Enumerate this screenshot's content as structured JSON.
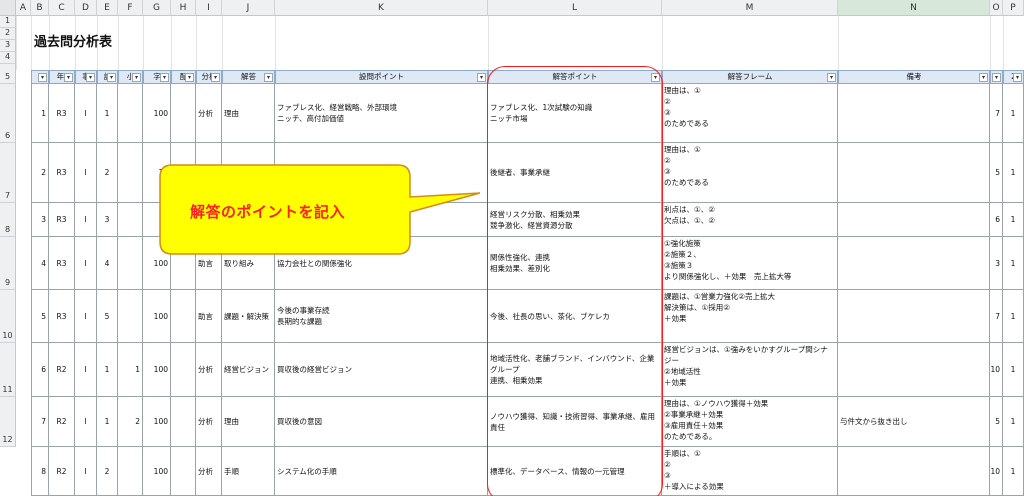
{
  "title": "過去問分析表",
  "columns": [
    "A",
    "B",
    "C",
    "D",
    "E",
    "F",
    "G",
    "H",
    "I",
    "J",
    "K",
    "L",
    "M",
    "N",
    "O",
    "P"
  ],
  "selected_column": "N",
  "row_numbers": [
    "1",
    "2",
    "3",
    "4",
    "5",
    "6",
    "7",
    "8",
    "9",
    "10",
    "11",
    "12"
  ],
  "header": [
    "I",
    "年(",
    "事",
    "設",
    "小",
    "字",
    "配",
    "分析",
    "解答",
    "設問ポイント",
    "解答ポイント",
    "解答フレーム",
    "備考",
    "1",
    "2"
  ],
  "rows": [
    {
      "n": "1",
      "year": "R3",
      "jirei": "I",
      "q": "1",
      "sub": "",
      "chars": "100",
      "haiten": "",
      "bunseki": "分析",
      "kaito": "理由",
      "setsumon": "ファブレス化、経営戦略、外部環境\nニッチ、高付加価値",
      "point": "ファブレス化、1次試験の知識\nニッチ市場",
      "frame": "理由は、①\n②\n③\nのためである",
      "biko": "",
      "o": "7",
      "p": "1"
    },
    {
      "n": "2",
      "year": "R3",
      "jirei": "I",
      "q": "2",
      "sub": "",
      "chars": "10",
      "haiten": "",
      "bunseki": "",
      "kaito": "",
      "setsumon": "",
      "point": "後継者、事業承継",
      "frame": "理由は、①\n②\n③\nのためである",
      "biko": "",
      "o": "5",
      "p": "1"
    },
    {
      "n": "3",
      "year": "R3",
      "jirei": "I",
      "q": "3",
      "sub": "",
      "chars": "1",
      "haiten": "",
      "bunseki": "",
      "kaito": "",
      "setsumon": "",
      "point": "経営リスク分散、相乗効果\n競争激化、経営資源分散",
      "frame": "利点は、①、②\n欠点は、①、②",
      "biko": "",
      "o": "6",
      "p": "1"
    },
    {
      "n": "4",
      "year": "R3",
      "jirei": "I",
      "q": "4",
      "sub": "",
      "chars": "100",
      "haiten": "",
      "bunseki": "助言",
      "kaito": "取り組み",
      "setsumon": "協力会社との関係強化",
      "point": "関係性強化、連携\n相乗効果、差別化",
      "frame": "①強化施策\n②施策２、\n③施策３\nより関係強化し、＋効果　売上拡大等",
      "biko": "",
      "o": "3",
      "p": "1"
    },
    {
      "n": "5",
      "year": "R3",
      "jirei": "I",
      "q": "5",
      "sub": "",
      "chars": "100",
      "haiten": "",
      "bunseki": "助言",
      "kaito": "課題・解決策",
      "setsumon": "今後の事業存続\n長期的な課題",
      "point": "今後、社長の思い、茶化、ブケレカ",
      "frame": "課題は、①営業力強化②売上拡大\n解決策は、①採用②\n＋効果",
      "biko": "",
      "o": "7",
      "p": "1"
    },
    {
      "n": "6",
      "year": "R2",
      "jirei": "I",
      "q": "1",
      "sub": "1",
      "chars": "100",
      "haiten": "",
      "bunseki": "分析",
      "kaito": "経営ビジョン",
      "setsumon": "買収後の経営ビジョン",
      "point": "地域活性化、老舗ブランド、インバウンド、企業グループ\n連携、相乗効果",
      "frame": "経営ビジョンは、①強みをいかすグループ間シナジー\n②地域活性\n＋効果",
      "biko": "",
      "o": "10",
      "p": "1"
    },
    {
      "n": "7",
      "year": "R2",
      "jirei": "I",
      "q": "1",
      "sub": "2",
      "chars": "100",
      "haiten": "",
      "bunseki": "分析",
      "kaito": "理由",
      "setsumon": "買収後の意図",
      "point": "ノウハウ獲得、知識・技術習得、事業承継、雇用責任",
      "frame": "理由は、①ノウハウ獲得＋効果\n②事業承継＋効果\n③雇用責任＋効果\nのためである。",
      "biko": "与件文から抜き出し",
      "o": "5",
      "p": "1"
    },
    {
      "n": "8",
      "year": "R2",
      "jirei": "I",
      "q": "2",
      "sub": "",
      "chars": "100",
      "haiten": "",
      "bunseki": "分析",
      "kaito": "手順",
      "setsumon": "システム化の手順",
      "point": "標準化、データベース、情報の一元管理",
      "frame": "手順は、①\n②\n③\n＋導入による効果",
      "biko": "",
      "o": "10",
      "p": "1"
    }
  ],
  "callout": {
    "text": "解答のポイントを記入",
    "fill": "#ffff00",
    "stroke": "#d48a18",
    "text_color": "#ff2020"
  },
  "highlight_color": "#ff1a1a"
}
